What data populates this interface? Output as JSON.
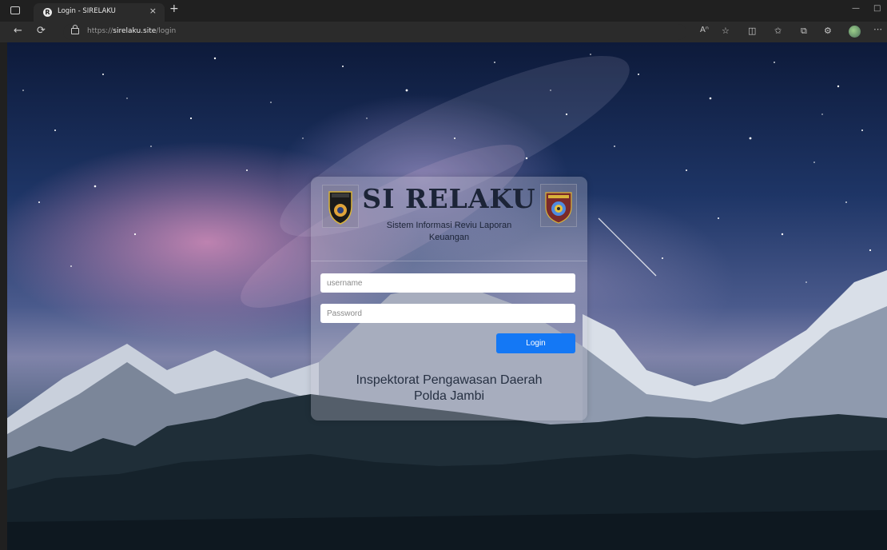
{
  "browser": {
    "tab_title": "Login - SIRELAKU",
    "tab_favicon": "R",
    "tab_close": "×",
    "new_tab": "+",
    "url_prefix": "https://",
    "url_host": "sirelaku.site",
    "url_path": "/login",
    "toolbar_icons": [
      "read-aloud-icon",
      "favorite-star-icon",
      "split-screen-icon",
      "favorites-icon",
      "collections-icon",
      "extensions-icon",
      "profile-icon",
      "more-icon"
    ]
  },
  "login": {
    "brand_title": "SI RELAKU",
    "brand_subtitle": "Sistem Informasi Reviu Laporan Keuangan",
    "username_placeholder": "username",
    "password_placeholder": "Password",
    "login_label": "Login",
    "org_line1": "Inspektorat Pengawasan Daerah",
    "org_line2": "Polda Jambi"
  },
  "colors": {
    "accent": "#1478f5",
    "brand_text": "#1c2437",
    "chrome_bg": "#202020"
  }
}
